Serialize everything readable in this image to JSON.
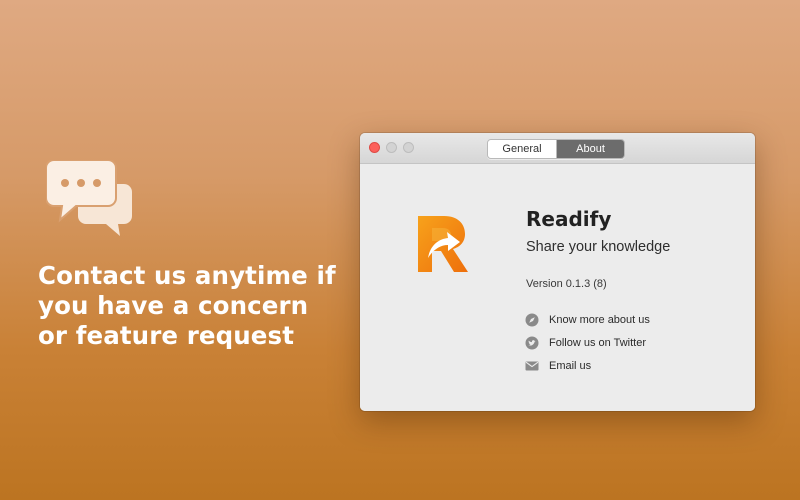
{
  "promo": {
    "icon": "chat-bubbles-icon",
    "message": "Contact us anytime if you have a concern or feature request"
  },
  "window": {
    "tabs": [
      {
        "label": "General",
        "selected": false
      },
      {
        "label": "About",
        "selected": true
      }
    ],
    "app": {
      "logo_icon": "readify-logo-icon",
      "name": "Readify",
      "tagline": "Share your knowledge",
      "version": "Version 0.1.3 (8)"
    },
    "links": [
      {
        "icon": "compass-icon",
        "label": "Know more about us"
      },
      {
        "icon": "twitter-icon",
        "label": "Follow us on Twitter"
      },
      {
        "icon": "mail-icon",
        "label": "Email us"
      }
    ]
  },
  "colors": {
    "background_top": "#dfa982",
    "background_bottom": "#bc7421",
    "close_button": "#fc605b",
    "selected_tab": "#6c6c6c",
    "logo_orange": "#f28c12"
  }
}
